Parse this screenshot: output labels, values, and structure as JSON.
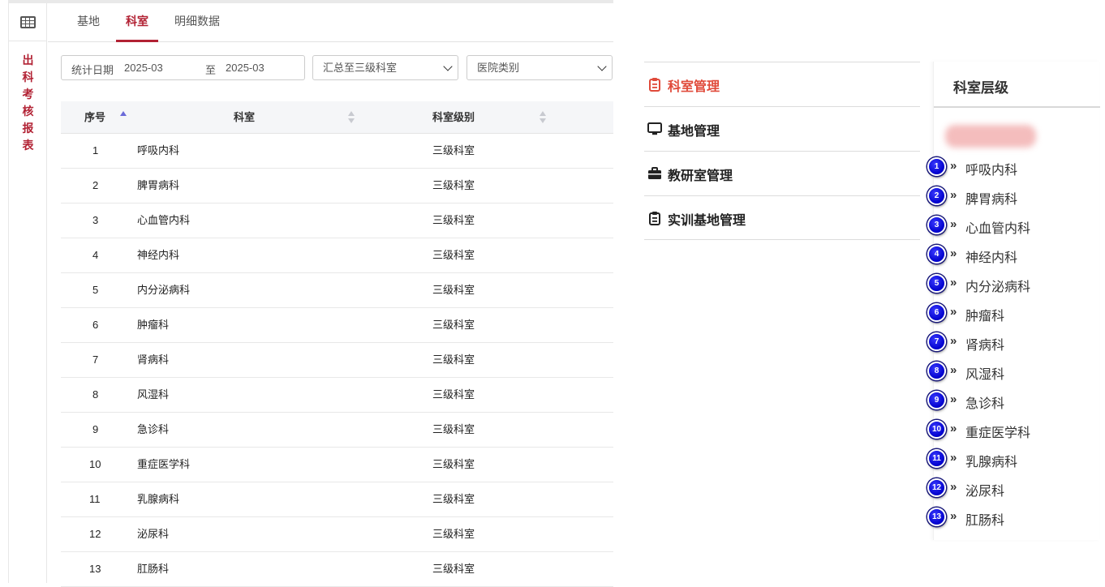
{
  "sidebar": {
    "title_chars": [
      "出",
      "科",
      "考",
      "核",
      "报",
      "表"
    ]
  },
  "tabs": [
    {
      "label": "基地",
      "active": false
    },
    {
      "label": "科室",
      "active": true
    },
    {
      "label": "明细数据",
      "active": false
    }
  ],
  "filters": {
    "date_label": "统计日期",
    "date_start": "2025-03",
    "date_sep": "至",
    "date_end": "2025-03",
    "level_select": "汇总至三级科室",
    "type_select": "医院类别"
  },
  "table": {
    "headers": [
      "序号",
      "科室",
      "科室级别"
    ],
    "rows": [
      {
        "no": "1",
        "dept": "呼吸内科",
        "level": "三级科室"
      },
      {
        "no": "2",
        "dept": "脾胃病科",
        "level": "三级科室"
      },
      {
        "no": "3",
        "dept": "心血管内科",
        "level": "三级科室"
      },
      {
        "no": "4",
        "dept": "神经内科",
        "level": "三级科室"
      },
      {
        "no": "5",
        "dept": "内分泌病科",
        "level": "三级科室"
      },
      {
        "no": "6",
        "dept": "肿瘤科",
        "level": "三级科室"
      },
      {
        "no": "7",
        "dept": "肾病科",
        "level": "三级科室"
      },
      {
        "no": "8",
        "dept": "风湿科",
        "level": "三级科室"
      },
      {
        "no": "9",
        "dept": "急诊科",
        "level": "三级科室"
      },
      {
        "no": "10",
        "dept": "重症医学科",
        "level": "三级科室"
      },
      {
        "no": "11",
        "dept": "乳腺病科",
        "level": "三级科室"
      },
      {
        "no": "12",
        "dept": "泌尿科",
        "level": "三级科室"
      },
      {
        "no": "13",
        "dept": "肛肠科",
        "level": "三级科室"
      }
    ]
  },
  "menu": [
    {
      "label": "科室管理",
      "icon": "clipboard-icon",
      "active": true
    },
    {
      "label": "基地管理",
      "icon": "monitor-icon",
      "active": false
    },
    {
      "label": "教研室管理",
      "icon": "briefcase-icon",
      "active": false
    },
    {
      "label": "实训基地管理",
      "icon": "clipboard-icon",
      "active": false
    }
  ],
  "right_panel": {
    "title": "科室层级",
    "chevron": "»",
    "items": [
      {
        "num": "1",
        "label": "呼吸内科"
      },
      {
        "num": "2",
        "label": "脾胃病科"
      },
      {
        "num": "3",
        "label": "心血管内科"
      },
      {
        "num": "4",
        "label": "神经内科"
      },
      {
        "num": "5",
        "label": "内分泌病科"
      },
      {
        "num": "6",
        "label": "肿瘤科"
      },
      {
        "num": "7",
        "label": "肾病科"
      },
      {
        "num": "8",
        "label": "风湿科"
      },
      {
        "num": "9",
        "label": "急诊科"
      },
      {
        "num": "10",
        "label": "重症医学科"
      },
      {
        "num": "11",
        "label": "乳腺病科"
      },
      {
        "num": "12",
        "label": "泌尿科"
      },
      {
        "num": "13",
        "label": "肛肠科"
      }
    ]
  },
  "colors": {
    "accent": "#b22234",
    "menu_active": "#e04a3a",
    "badge": "#0000cc"
  }
}
